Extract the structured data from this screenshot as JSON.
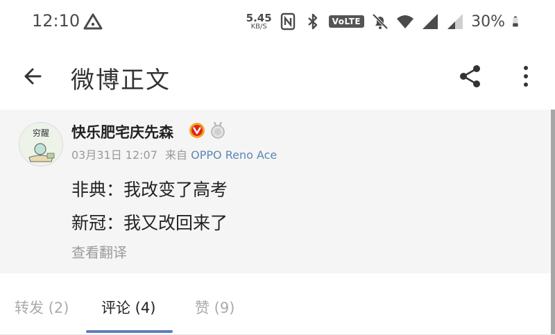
{
  "status_bar": {
    "time": "12:10",
    "net_speed_value": "5.45",
    "net_speed_unit": "KB/S",
    "volte": "VoLTE",
    "battery": "30%",
    "icons": [
      "alert-triangle-icon",
      "nfc-icon",
      "bluetooth-icon",
      "volte-icon",
      "bell-off-icon",
      "wifi-icon",
      "signal-icon",
      "battery-icon"
    ]
  },
  "app_bar": {
    "title": "微博正文",
    "icons": [
      "back-arrow-icon",
      "share-icon",
      "more-vert-icon"
    ]
  },
  "post": {
    "avatar_text": "穷醒",
    "author": "快乐肥宅庆先森",
    "time": "03月31日 12:07",
    "from_label": "来自",
    "source": "OPPO Reno Ace",
    "lines": [
      "非典：我改变了高考",
      "新冠：我又改回来了"
    ],
    "translate_label": "查看翻译"
  },
  "tabs": [
    {
      "label": "转发 (2)",
      "active": false
    },
    {
      "label": "评论 (4)",
      "active": true
    },
    {
      "label": "赞 (9)",
      "active": false
    }
  ],
  "colors": {
    "accent": "#5b7fb8",
    "source_link": "#5b86b4",
    "verified_badge": "#f5a623",
    "post_bg": "#f5f5f5"
  }
}
